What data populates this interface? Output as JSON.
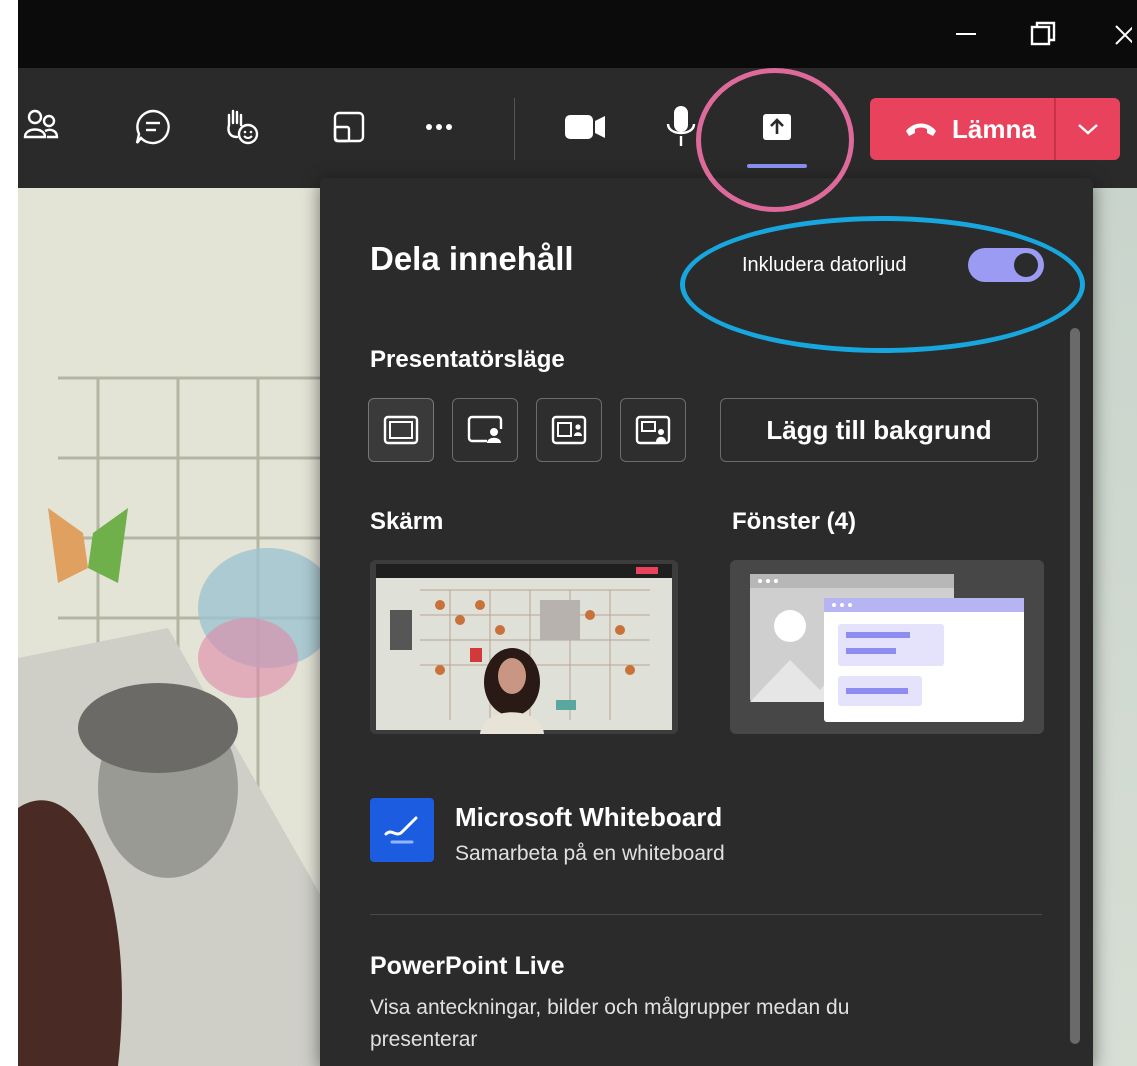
{
  "toolbar": {
    "leave_label": "Lämna",
    "icons": [
      "people-icon",
      "chat-icon",
      "raise-hand-icon",
      "rooms-icon",
      "more-icon",
      "camera-icon",
      "mic-icon",
      "share-icon"
    ]
  },
  "panel": {
    "title": "Dela innehåll",
    "audio_label": "Inkludera datorljud",
    "audio_on": true,
    "presenter_label": "Presentatörsläge",
    "add_background": "Lägg till bakgrund",
    "screen_label": "Skärm",
    "window_label": "Fönster (4)",
    "whiteboard_title": "Microsoft Whiteboard",
    "whiteboard_sub": "Samarbeta på en whiteboard",
    "powerpoint_title": "PowerPoint Live",
    "powerpoint_sub": "Visa anteckningar, bilder och målgrupper medan du presenterar"
  },
  "colors": {
    "accent": "#9b9bf3",
    "leave": "#e8425c",
    "highlight_pink": "#de6a9b",
    "highlight_blue": "#17a6de"
  }
}
